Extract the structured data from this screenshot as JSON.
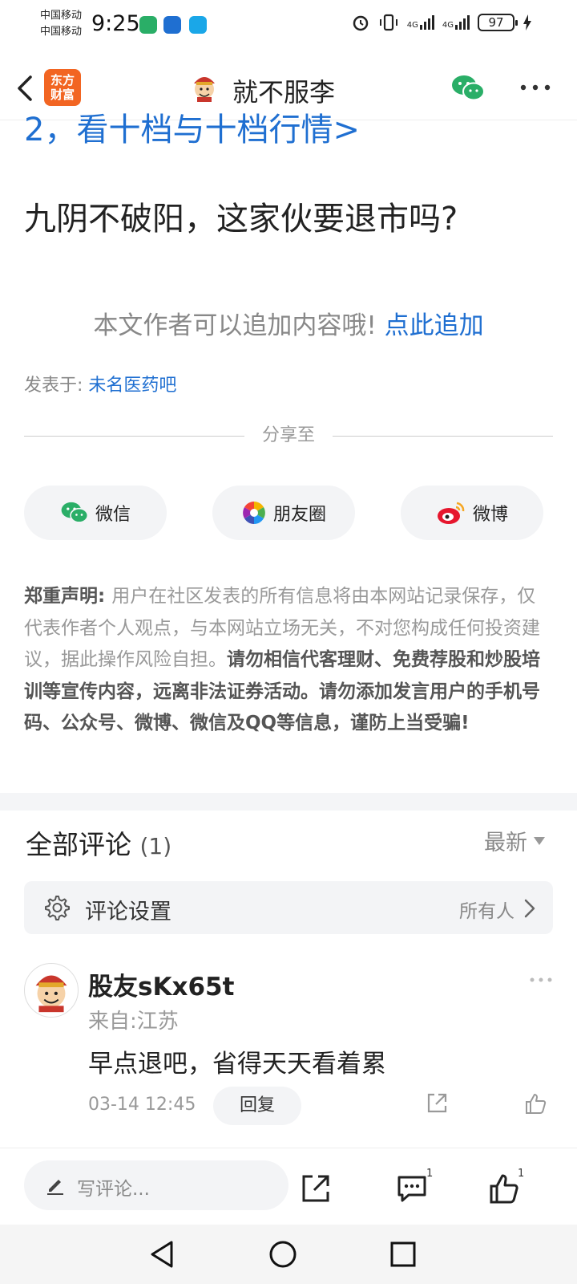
{
  "status_bar": {
    "carrier_1": "中国移动",
    "carrier_2": "中国移动",
    "time": "9:25",
    "battery": "97",
    "signal_1": "4G",
    "signal_2": "4G"
  },
  "header": {
    "brand_line1": "东方",
    "brand_line2": "财富",
    "title": "就不服李"
  },
  "article": {
    "cut_link": "2，看十档与十档行情>",
    "text": "九阴不破阳，这家伙要退市吗?",
    "append_prompt": "本文作者可以追加内容哦! ",
    "append_link": "点此追加",
    "posted_in_label": "发表于: ",
    "posted_in_bar": "未名医药吧"
  },
  "share": {
    "label": "分享至",
    "wechat": "微信",
    "moments": "朋友圈",
    "weibo": "微博"
  },
  "disclaimer": {
    "title": "郑重声明: ",
    "body": "用户在社区发表的所有信息将由本网站记录保存，仅代表作者个人观点，与本网站立场无关，不对您构成任何投资建议，据此操作风险自担。",
    "warning": "请勿相信代客理财、免费荐股和炒股培训等宣传内容，远离非法证券活动。请勿添加发言用户的手机号码、公众号、微博、微信及QQ等信息，谨防上当受骗!"
  },
  "comments": {
    "title": "全部评论",
    "count": "(1)",
    "sort": "最新",
    "settings_label": "评论设置",
    "settings_value": "所有人",
    "items": [
      {
        "user": "股友sKx65t",
        "location": "来自:江苏",
        "text": "早点退吧，省得天天看着累",
        "time": "03-14 12:45",
        "reply": "回复"
      }
    ]
  },
  "bottom_bar": {
    "write_placeholder": "写评论...",
    "comment_count": "1",
    "like_count": "1"
  },
  "colors": {
    "link_blue": "#1f6fd1",
    "brand_orange": "#f26522",
    "wechat_green": "#2aae67"
  }
}
